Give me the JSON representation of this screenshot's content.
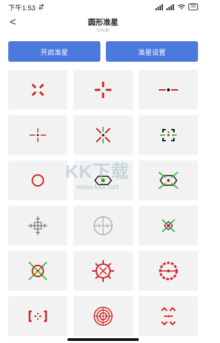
{
  "status": {
    "time": "下午1:53",
    "battery": "55"
  },
  "header": {
    "back": "<",
    "title": "圆形准星",
    "subtitle": "Circle"
  },
  "buttons": {
    "start": "开启准星",
    "settings": "准星设置"
  },
  "watermark": {
    "big": "KK下载",
    "small": "www.kkx.net"
  },
  "colors": {
    "accent": "#4a7bdc",
    "red": "#d21f1f",
    "green": "#3cc43c"
  },
  "crosshairs": [
    "red-split-cross",
    "red-cross-gap",
    "line-dot",
    "thin-cross-dot",
    "red-green-x-cross",
    "corner-brackets",
    "red-circle",
    "hexagon-green-dot",
    "hexagon-red-green",
    "ruler-cross",
    "circle-target",
    "green-x-diamond",
    "x-circle-green",
    "spiked-ring",
    "segmented-ring",
    "bracket-dashes",
    "concentric-circles",
    "chevron-circle"
  ]
}
